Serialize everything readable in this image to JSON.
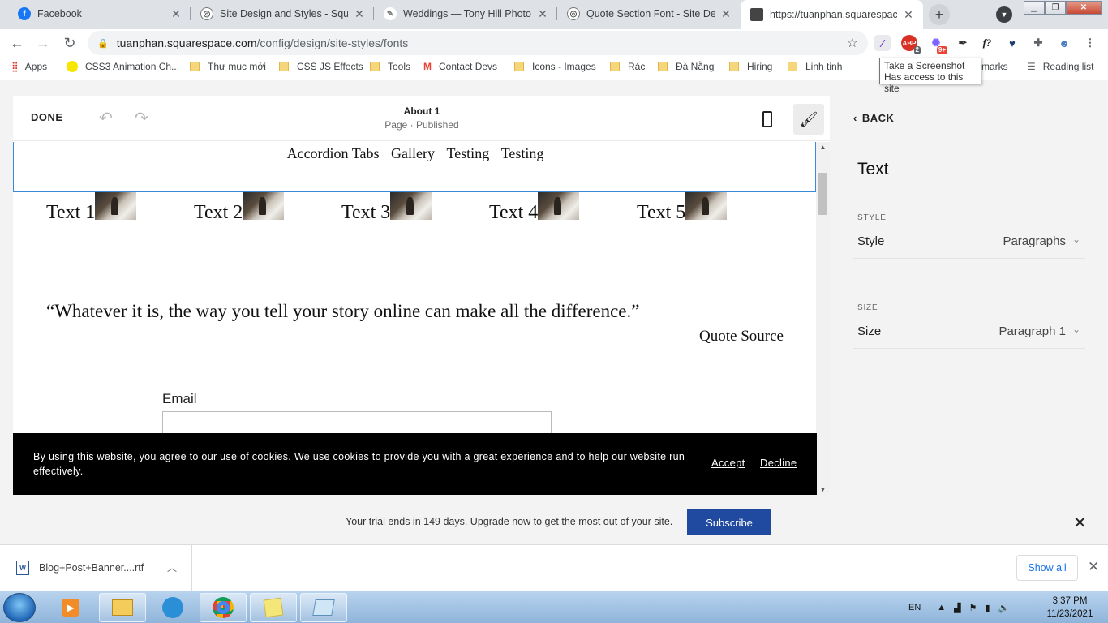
{
  "browser": {
    "tabs": [
      {
        "label": "Facebook",
        "icon": "facebook-icon",
        "color": "#1877f2",
        "glyph": "f"
      },
      {
        "label": "Site Design and Styles - Squarespace",
        "icon": "squarespace-icon",
        "color": "#555555",
        "glyph": "◎"
      },
      {
        "label": "Weddings — Tony Hill Photography",
        "icon": "photography-icon",
        "color": "#777777",
        "glyph": "✎"
      },
      {
        "label": "Quote Section Font - Site Design",
        "icon": "squarespace-icon",
        "color": "#555555",
        "glyph": "◎"
      },
      {
        "label": "https://tuanphan.squarespace.com",
        "icon": "cube-icon",
        "color": "#444444",
        "glyph": "■"
      }
    ],
    "url_host": "tuanphan.squarespace.com",
    "url_path": "/config/design/site-styles/fonts",
    "extension_badges": {
      "abp": "2",
      "notify": "9+"
    },
    "bookmarks": [
      {
        "label": "Apps",
        "type": "apps"
      },
      {
        "label": "CSS3 Animation Ch...",
        "type": "dot"
      },
      {
        "label": "Thư mục mới",
        "type": "folder"
      },
      {
        "label": "CSS JS Effects",
        "type": "folder"
      },
      {
        "label": "Tools",
        "type": "folder"
      },
      {
        "label": "Contact Devs",
        "type": "gmail"
      },
      {
        "label": "Icons - Images",
        "type": "folder"
      },
      {
        "label": "Rác",
        "type": "folder"
      },
      {
        "label": "Đà Nẵng",
        "type": "folder"
      },
      {
        "label": "Hiring",
        "type": "folder"
      },
      {
        "label": "Linh tinh",
        "type": "folder"
      }
    ],
    "bookmarks_right": {
      "other": "marks",
      "reading": "Reading list"
    },
    "tooltip": {
      "line1": "Take a Screenshot",
      "line2": "Has access to this site"
    }
  },
  "editor": {
    "done_label": "DONE",
    "page_title": "About 1",
    "page_status": "Page · Published"
  },
  "site": {
    "nav_links": [
      "Accordion Tabs",
      "Gallery",
      "Testing",
      "Testing"
    ],
    "text_items": [
      "Text 1",
      "Text 2",
      "Text 3",
      "Text 4",
      "Text 5"
    ],
    "quote": "“Whatever it is, the way you tell your story online can make all the difference.”",
    "quote_source": "— Quote Source",
    "email_label": "Email"
  },
  "cookie": {
    "text": "By using this website, you agree to our use of cookies. We use cookies to provide you with a great experience and to help our website run effectively.",
    "accept": "Accept",
    "decline": "Decline"
  },
  "panel": {
    "back_label": "BACK",
    "title": "Text",
    "style_section": "STYLE",
    "style_name": "Style",
    "style_value": "Paragraphs",
    "size_section": "SIZE",
    "size_name": "Size",
    "size_value": "Paragraph 1"
  },
  "trial": {
    "text": "Your trial ends in 149 days. Upgrade now to get the most out of your site.",
    "button": "Subscribe"
  },
  "downloads": {
    "file_name": "Blog+Post+Banner....rtf",
    "show_all": "Show all"
  },
  "taskbar": {
    "language": "EN",
    "time": "3:37 PM",
    "date": "11/23/2021"
  },
  "colors": {
    "accent_blue": "#1f4aa0",
    "selection_blue": "#3b8ad9",
    "cookie_bg": "#000000"
  }
}
